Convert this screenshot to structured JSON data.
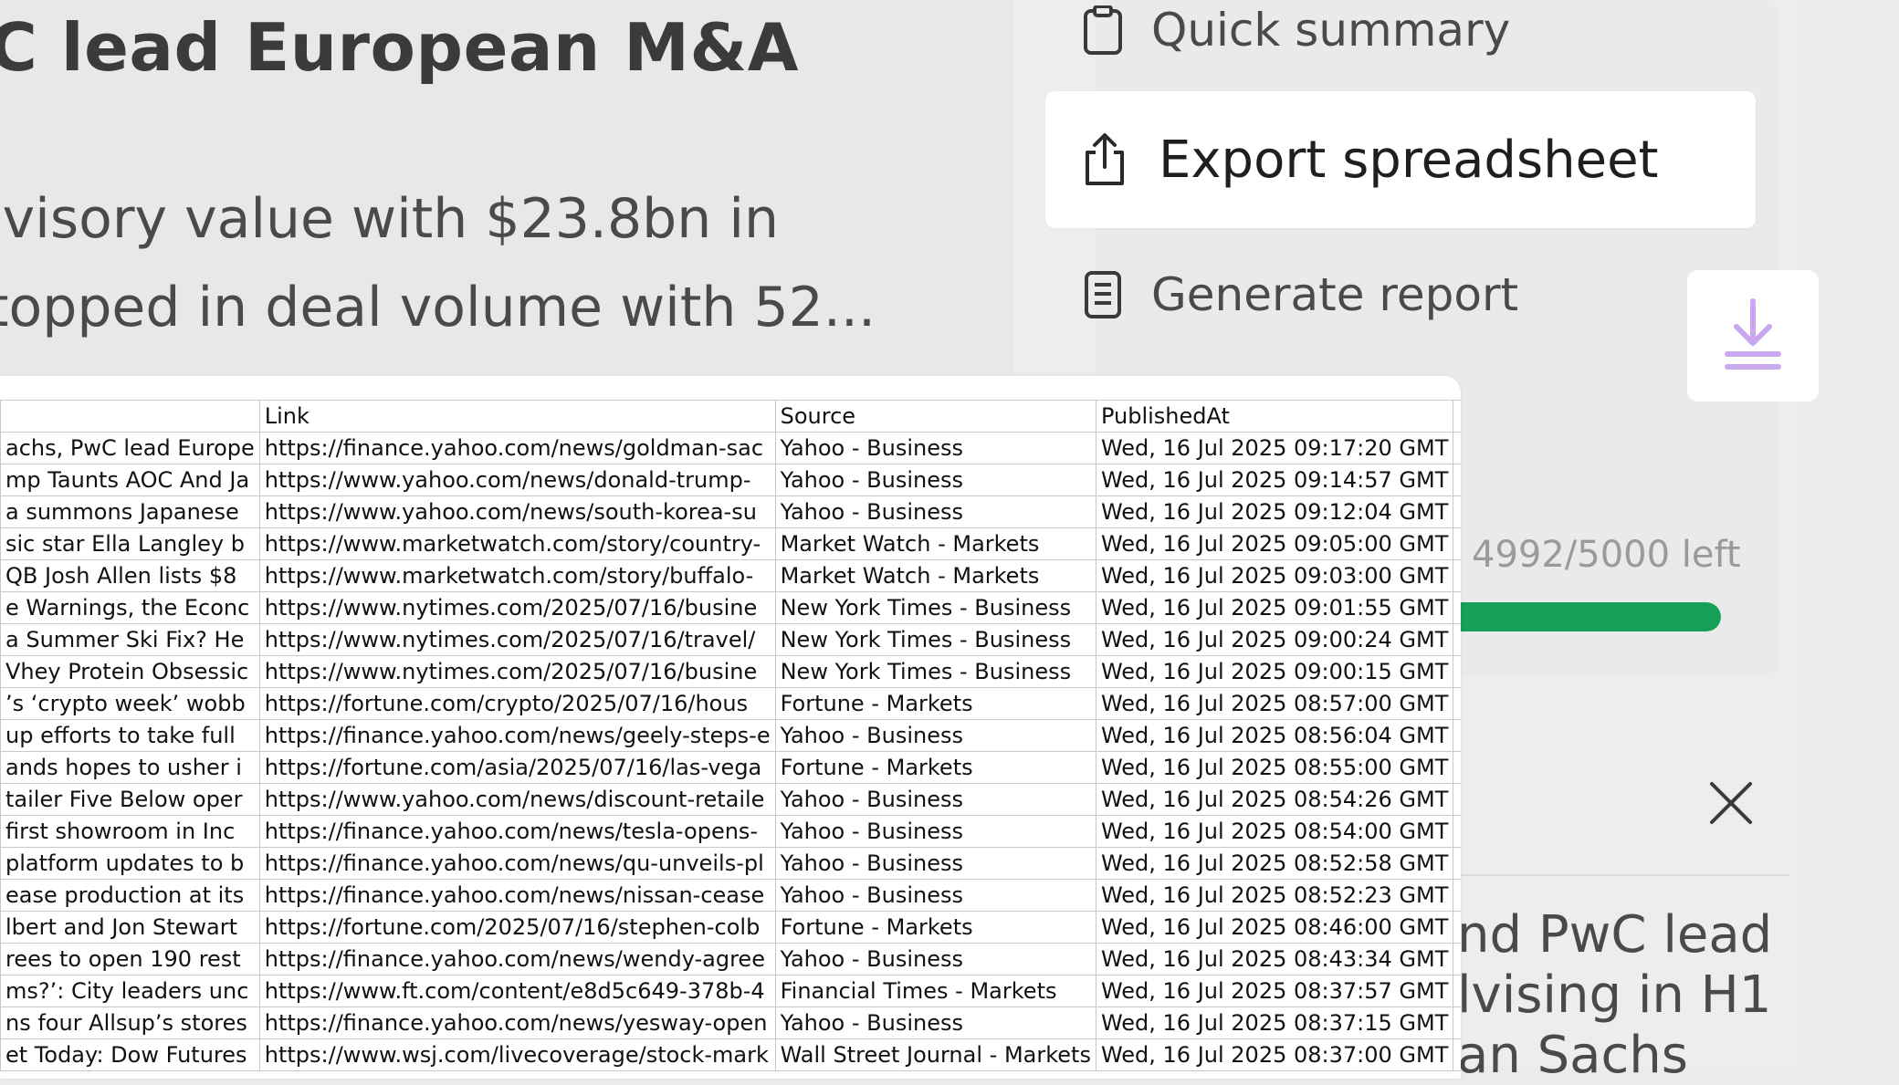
{
  "article": {
    "headline": "C lead European M&A",
    "summary_line1": "lvisory value with $23.8bn in",
    "summary_line2": "topped in deal volume with 52..."
  },
  "menu": {
    "quick_summary": "Quick summary",
    "export_spreadsheet": "Export spreadsheet",
    "generate_report": "Generate report"
  },
  "quota": {
    "text": "4992/5000 left",
    "used": 8,
    "total": 5000,
    "fill_fraction": 0.9984,
    "color": "#16a05a"
  },
  "bg_card": {
    "line1": "nd PwC lead",
    "line2": "lvising in H1",
    "line3": "an Sachs"
  },
  "spreadsheet": {
    "headers": [
      "",
      "Link",
      "Source",
      "PublishedAt",
      ""
    ],
    "rows": [
      [
        "achs, PwC lead Europe",
        "https://finance.yahoo.com/news/goldman-sac",
        "Yahoo - Business",
        "Wed, 16 Jul 2025 09:17:20 GMT"
      ],
      [
        "mp Taunts AOC And Ja",
        "https://www.yahoo.com/news/donald-trump-",
        "Yahoo - Business",
        "Wed, 16 Jul 2025 09:14:57 GMT"
      ],
      [
        "a summons Japanese ",
        "https://www.yahoo.com/news/south-korea-su",
        "Yahoo - Business",
        "Wed, 16 Jul 2025 09:12:04 GMT"
      ],
      [
        "sic star Ella Langley b",
        "https://www.marketwatch.com/story/country-",
        "Market Watch - Markets",
        "Wed, 16 Jul 2025 09:05:00 GMT"
      ],
      [
        " QB Josh Allen lists $8",
        "https://www.marketwatch.com/story/buffalo-",
        "Market Watch - Markets",
        "Wed, 16 Jul 2025 09:03:00 GMT"
      ],
      [
        "e Warnings, the Econc",
        "https://www.nytimes.com/2025/07/16/busine",
        "New York Times - Business",
        "Wed, 16 Jul 2025 09:01:55 GMT"
      ],
      [
        "a Summer Ski Fix? He",
        "https://www.nytimes.com/2025/07/16/travel/",
        "New York Times - Business",
        "Wed, 16 Jul 2025 09:00:24 GMT"
      ],
      [
        "Vhey Protein Obsessic",
        "https://www.nytimes.com/2025/07/16/busine",
        "New York Times - Business",
        "Wed, 16 Jul 2025 09:00:15 GMT"
      ],
      [
        "’s ‘crypto week’ wobb",
        "https://fortune.com/crypto/2025/07/16/hous",
        "Fortune - Markets",
        "Wed, 16 Jul 2025 08:57:00 GMT"
      ],
      [
        " up efforts to take full",
        "https://finance.yahoo.com/news/geely-steps-e",
        "Yahoo - Business",
        "Wed, 16 Jul 2025 08:56:04 GMT"
      ],
      [
        "ands hopes to usher i",
        "https://fortune.com/asia/2025/07/16/las-vega",
        "Fortune - Markets",
        "Wed, 16 Jul 2025 08:55:00 GMT"
      ],
      [
        "tailer Five Below oper",
        "https://www.yahoo.com/news/discount-retaile",
        "Yahoo - Business",
        "Wed, 16 Jul 2025 08:54:26 GMT"
      ],
      [
        " first showroom in Inc",
        "https://finance.yahoo.com/news/tesla-opens-",
        "Yahoo - Business",
        "Wed, 16 Jul 2025 08:54:00 GMT"
      ],
      [
        "platform updates to b",
        "https://finance.yahoo.com/news/qu-unveils-pl",
        "Yahoo - Business",
        "Wed, 16 Jul 2025 08:52:58 GMT"
      ],
      [
        "ease production at its",
        "https://finance.yahoo.com/news/nissan-cease",
        "Yahoo - Business",
        "Wed, 16 Jul 2025 08:52:23 GMT"
      ],
      [
        "lbert and Jon Stewart",
        "https://fortune.com/2025/07/16/stephen-colb",
        "Fortune - Markets",
        "Wed, 16 Jul 2025 08:46:00 GMT"
      ],
      [
        "rees to open 190 rest",
        "https://finance.yahoo.com/news/wendy-agree",
        "Yahoo - Business",
        "Wed, 16 Jul 2025 08:43:34 GMT"
      ],
      [
        "ms?’: City leaders unc",
        "https://www.ft.com/content/e8d5c649-378b-4",
        "Financial Times - Markets",
        "Wed, 16 Jul 2025 08:37:57 GMT"
      ],
      [
        "ns four Allsup’s stores",
        "https://finance.yahoo.com/news/yesway-open",
        "Yahoo - Business",
        "Wed, 16 Jul 2025 08:37:15 GMT"
      ],
      [
        "et Today: Dow Futures",
        "https://www.wsj.com/livecoverage/stock-mark",
        "Wall Street Journal - Markets",
        "Wed, 16 Jul 2025 08:37:00 GMT"
      ]
    ]
  },
  "icons": {
    "quick_summary": "clipboard-icon",
    "export": "share-upload-icon",
    "report": "document-icon",
    "download": "download-icon",
    "close": "close-icon"
  },
  "colors": {
    "accent_purple": "#c9a8f0",
    "progress_green": "#16a05a"
  }
}
